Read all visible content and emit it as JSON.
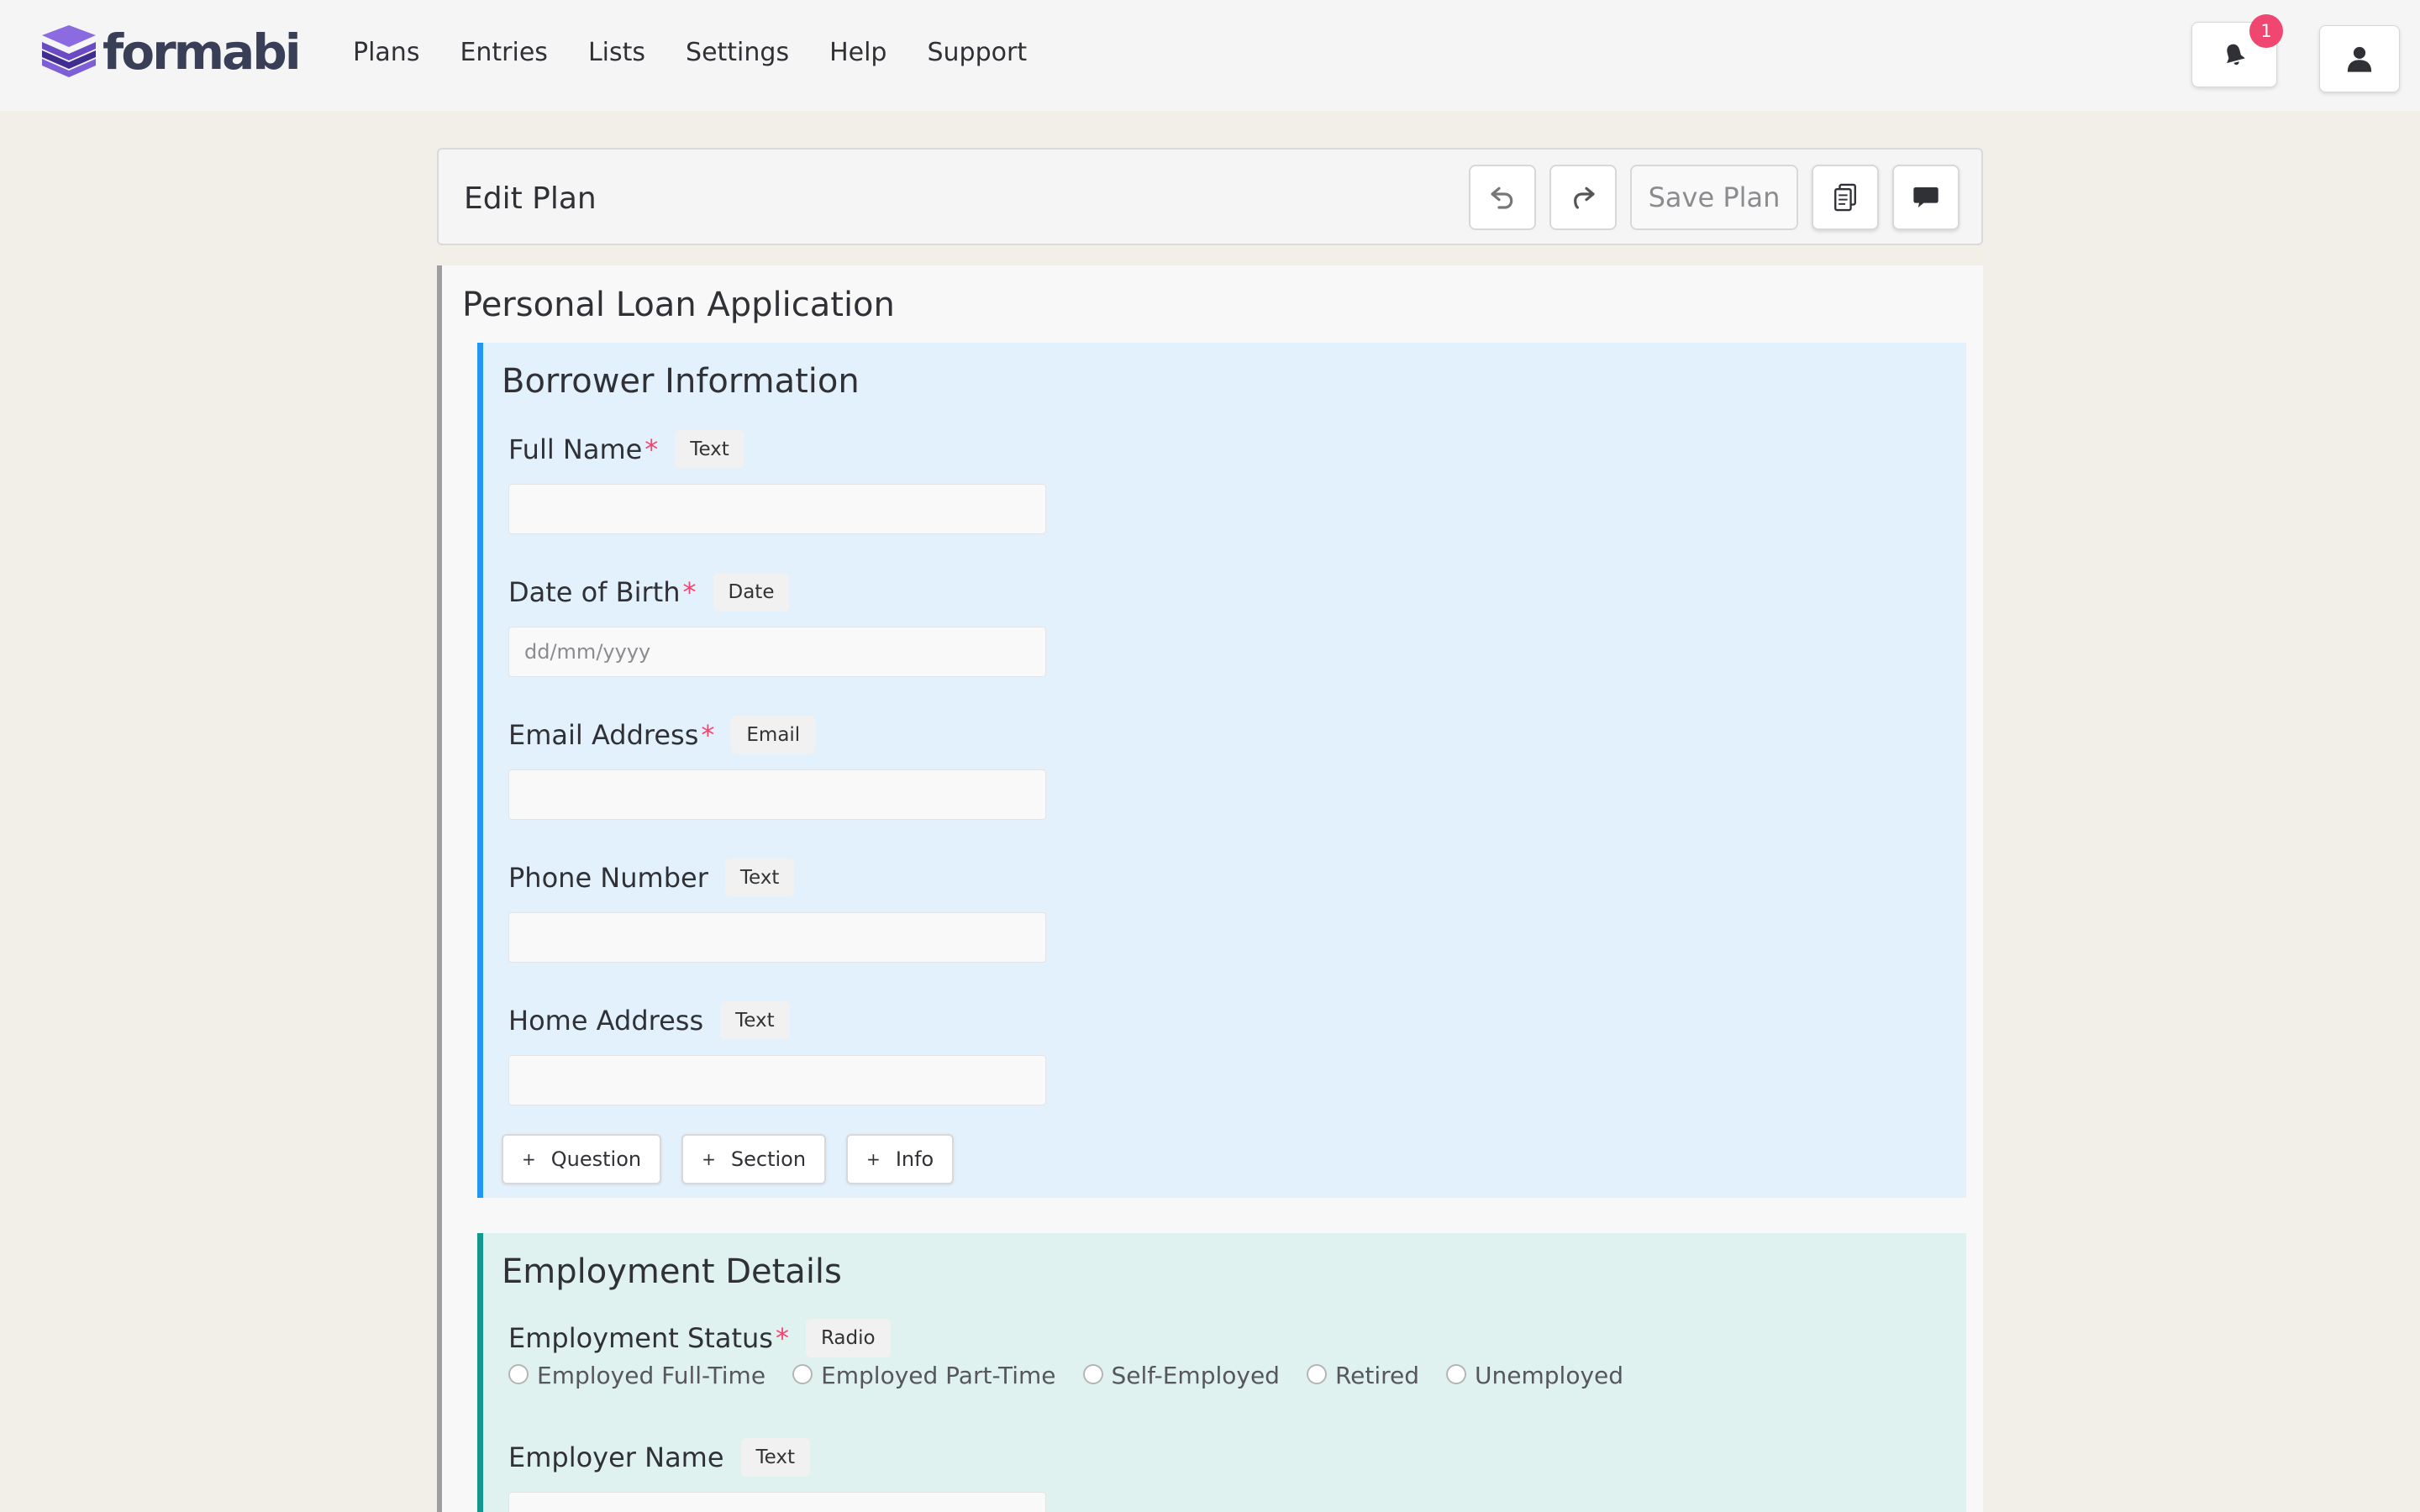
{
  "brand": {
    "name": "formabi",
    "colors": {
      "logo_top": "#6a4bc4",
      "logo_mid": "#8c6be0",
      "logo_text": "#3a3f58"
    }
  },
  "nav": {
    "items": [
      "Plans",
      "Entries",
      "Lists",
      "Settings",
      "Help",
      "Support"
    ]
  },
  "notifications": {
    "count": "1",
    "icon": "bell-icon"
  },
  "user": {
    "icon": "user-icon"
  },
  "toolbar": {
    "title": "Edit Plan",
    "undo_icon": "undo-icon",
    "redo_icon": "redo-icon",
    "save_label": "Save Plan",
    "copy_icon": "document-copy-icon",
    "comment_icon": "comment-icon"
  },
  "plan": {
    "title": "Personal Loan Application",
    "sections": [
      {
        "title": "Borrower Information",
        "accent": "#2196f3",
        "fields": [
          {
            "label": "Full Name",
            "required": true,
            "type": "Text",
            "placeholder": ""
          },
          {
            "label": "Date of Birth",
            "required": true,
            "type": "Date",
            "placeholder": "dd/mm/yyyy"
          },
          {
            "label": "Email Address",
            "required": true,
            "type": "Email",
            "placeholder": ""
          },
          {
            "label": "Phone Number",
            "required": false,
            "type": "Text",
            "placeholder": ""
          },
          {
            "label": "Home Address",
            "required": false,
            "type": "Text",
            "placeholder": ""
          }
        ],
        "add_buttons": [
          "Question",
          "Section",
          "Info"
        ]
      },
      {
        "title": "Employment Details",
        "accent": "#11998e",
        "fields": [
          {
            "label": "Employment Status",
            "required": true,
            "type": "Radio",
            "options": [
              "Employed Full-Time",
              "Employed Part-Time",
              "Self-Employed",
              "Retired",
              "Unemployed"
            ]
          },
          {
            "label": "Employer Name",
            "required": false,
            "type": "Text",
            "placeholder": ""
          }
        ]
      }
    ]
  },
  "req_marker": "*",
  "plus_symbol": "+"
}
